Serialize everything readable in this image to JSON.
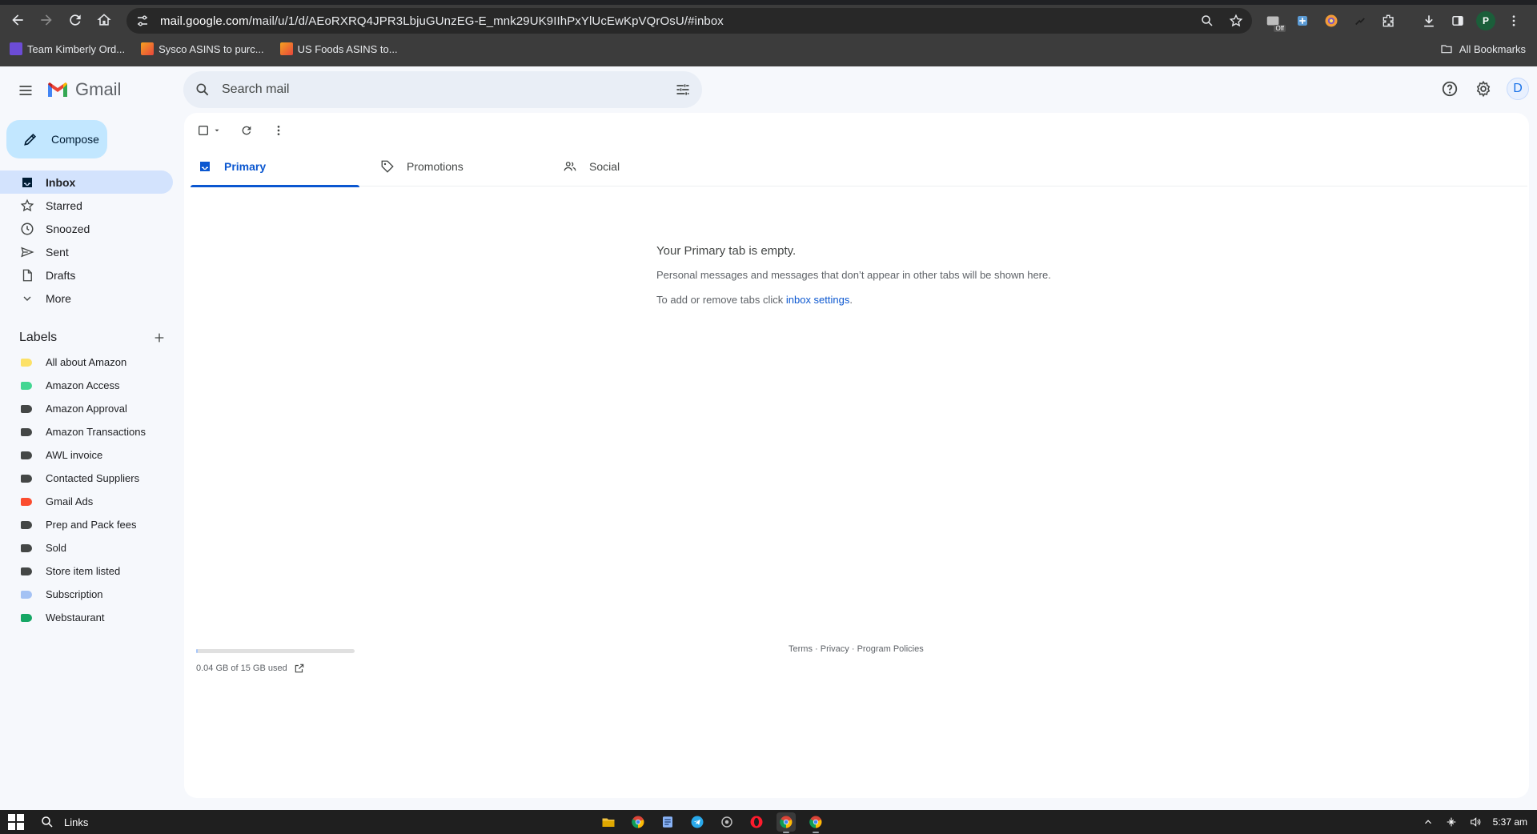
{
  "browser": {
    "url_host": "mail.google.com",
    "url_path": "/mail/u/1/d/AEoRXRQ4JPR3LbjuGUnzEG-E_mnk29UK9IIhPxYlUcEwKpVQrOsU/#inbox",
    "profile_initial": "P",
    "extension_badge": "Off",
    "bookmarks": [
      {
        "label": "Team Kimberly Ord...",
        "color": "#6c4cd6"
      },
      {
        "label": "Sysco ASINS to purc...",
        "color": "#f4a120"
      },
      {
        "label": "US Foods ASINS to...",
        "color": "#f4a120"
      }
    ],
    "all_bookmarks_label": "All Bookmarks"
  },
  "gmail": {
    "product_name": "Gmail",
    "search_placeholder": "Search mail",
    "avatar_initial": "D",
    "compose_label": "Compose",
    "nav": [
      {
        "label": "Inbox",
        "icon": "inbox-icon",
        "active": true
      },
      {
        "label": "Starred",
        "icon": "star-icon",
        "active": false
      },
      {
        "label": "Snoozed",
        "icon": "clock-icon",
        "active": false
      },
      {
        "label": "Sent",
        "icon": "send-icon",
        "active": false
      },
      {
        "label": "Drafts",
        "icon": "draft-icon",
        "active": false
      },
      {
        "label": "More",
        "icon": "chevron-down-icon",
        "active": false
      }
    ],
    "labels_title": "Labels",
    "labels": [
      {
        "label": "All about Amazon",
        "color": "#fce167"
      },
      {
        "label": "Amazon Access",
        "color": "#43d692"
      },
      {
        "label": "Amazon Approval",
        "color": "#444746"
      },
      {
        "label": "Amazon Transactions",
        "color": "#444746"
      },
      {
        "label": "AWL invoice",
        "color": "#444746"
      },
      {
        "label": "Contacted Suppliers",
        "color": "#444746"
      },
      {
        "label": "Gmail Ads",
        "color": "#fb4c2f"
      },
      {
        "label": "Prep and Pack fees",
        "color": "#444746"
      },
      {
        "label": "Sold",
        "color": "#444746"
      },
      {
        "label": "Store item listed",
        "color": "#444746"
      },
      {
        "label": "Subscription",
        "color": "#a4c2f4"
      },
      {
        "label": "Webstaurant",
        "color": "#16a765"
      }
    ],
    "tabs": [
      {
        "label": "Primary",
        "icon": "inbox-tab-icon",
        "active": true
      },
      {
        "label": "Promotions",
        "icon": "tag-icon",
        "active": false
      },
      {
        "label": "Social",
        "icon": "people-icon",
        "active": false
      }
    ],
    "empty_state": {
      "heading": "Your Primary tab is empty.",
      "line1": "Personal messages and messages that don’t appear in other tabs will be shown here.",
      "line2_prefix": "To add or remove tabs click ",
      "line2_link": "inbox settings",
      "line2_suffix": "."
    },
    "storage": {
      "text": "0.04 GB of 15 GB used",
      "used_fraction": 0.003
    },
    "footer": {
      "terms": "Terms",
      "privacy": "Privacy",
      "policies": "Program Policies",
      "sep": " · "
    },
    "accent_color": "#0b57d0"
  },
  "taskbar": {
    "search_label": "Links",
    "time": "5:37 am"
  }
}
